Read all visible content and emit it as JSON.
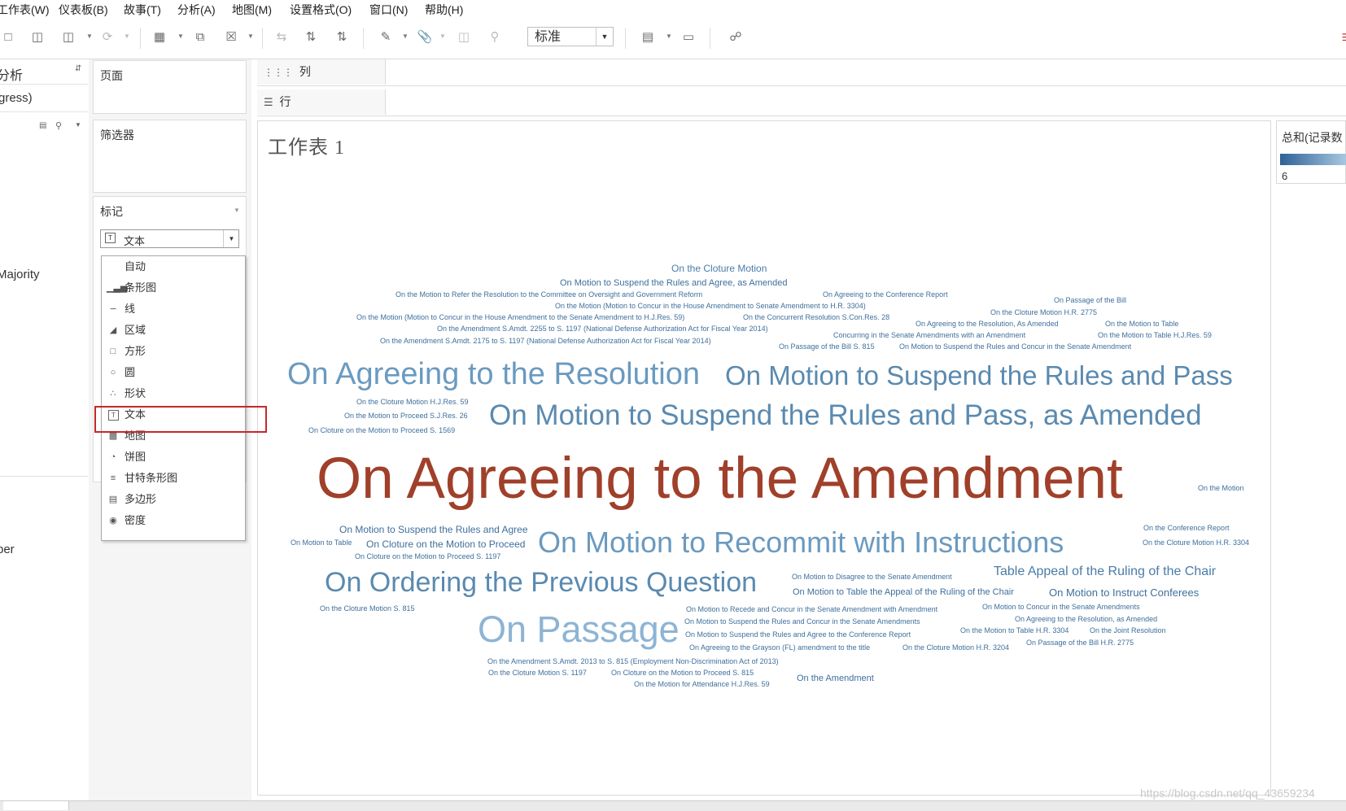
{
  "menu": [
    "工作表(W)",
    "仪表板(B)",
    "故事(T)",
    "分析(A)",
    "地图(M)",
    "设置格式(O)",
    "窗口(N)",
    "帮助(H)"
  ],
  "toolbar": {
    "fit_value": "标准",
    "icons": [
      "save-icon",
      "new-datasource-icon",
      "pause-datasource-icon",
      "refresh-icon",
      "new-worksheet-icon",
      "duplicate-sheet-icon",
      "clear-sheet-icon",
      "swap-icon",
      "sort-ascending-icon",
      "sort-descending-icon",
      "highlight-icon",
      "group-icon",
      "label-icon",
      "pin-icon",
      "show-me-icon",
      "presentation-icon",
      "share-icon"
    ]
  },
  "data_pane": {
    "header": "分析",
    "source": "gress)",
    "field_majority": "Majority",
    "field_ber": "ber"
  },
  "cards": {
    "pages": "页面",
    "filters": "筛选器",
    "marks": "标记",
    "mark_type": "文本"
  },
  "shelves": {
    "columns": "列",
    "rows": "行"
  },
  "view": {
    "title": "工作表 1",
    "words": [
      {
        "text": "On Agreeing to the Amendment",
        "color": "#a0402a"
      },
      {
        "text": "On Motion to Suspend the Rules and Pass, as Amended",
        "color": "#5a8ab0"
      },
      {
        "text": "On Motion to Suspend the Rules and Pass",
        "color": "#5a8ab0"
      },
      {
        "text": "On Agreeing to the Resolution",
        "color": "#6a9ac0"
      },
      {
        "text": "On Motion to Recommit with Instructions",
        "color": "#6a9ac0"
      },
      {
        "text": "On Ordering the Previous Question",
        "color": "#5a8ab0"
      },
      {
        "text": "On Passage",
        "color": "#8db4d4"
      },
      {
        "text": "On the Cloture Motion",
        "color": "#4a7ca8"
      },
      {
        "text": "On Motion to Suspend the Rules and Agree, as Amended",
        "color": "#3e6f9c"
      },
      {
        "text": "On the Motion to Refer the Resolution to the Committee on Oversight and Government Reform",
        "color": "#3e6f9c"
      },
      {
        "text": "On Agreeing to the Conference Report",
        "color": "#3e6f9c"
      },
      {
        "text": "On the Motion (Motion to Concur in the House Amendment to Senate Amendment to H.R. 3304)",
        "color": "#3e6f9c"
      },
      {
        "text": "On Passage of the Bill",
        "color": "#3e6f9c"
      },
      {
        "text": "On the Motion (Motion to Concur in the House Amendment to the Senate Amendment to H.J.Res. 59)",
        "color": "#3e6f9c"
      },
      {
        "text": "On the Concurrent Resolution S.Con.Res. 28",
        "color": "#3e6f9c"
      },
      {
        "text": "On the Cloture Motion H.R. 2775",
        "color": "#3e6f9c"
      },
      {
        "text": "On the Amendment S.Amdt. 2255 to S. 1197 (National Defense Authorization Act for Fiscal Year 2014)",
        "color": "#3e6f9c"
      },
      {
        "text": "On Agreeing to the Resolution, As Amended",
        "color": "#3e6f9c"
      },
      {
        "text": "On the Motion to Table",
        "color": "#3e6f9c"
      },
      {
        "text": "Concurring in the Senate Amendments with an Amendment",
        "color": "#3e6f9c"
      },
      {
        "text": "On the Motion to Table H.J.Res. 59",
        "color": "#3e6f9c"
      },
      {
        "text": "On the Amendment S.Amdt. 2175 to S. 1197 (National Defense Authorization Act for Fiscal Year 2014)",
        "color": "#3e6f9c"
      },
      {
        "text": "On Passage of the Bill S. 815",
        "color": "#3e6f9c"
      },
      {
        "text": "On Motion to Suspend the Rules and Concur in the Senate Amendment",
        "color": "#3e6f9c"
      },
      {
        "text": "On the Cloture Motion H.J.Res. 59",
        "color": "#3e6f9c"
      },
      {
        "text": "On the Motion to Proceed S.J.Res. 26",
        "color": "#3e6f9c"
      },
      {
        "text": "On Cloture on the Motion to Proceed S. 1569",
        "color": "#3e6f9c"
      },
      {
        "text": "On the Motion",
        "color": "#3e6f9c"
      },
      {
        "text": "On Motion to Suspend the Rules and Agree",
        "color": "#3e6f9c"
      },
      {
        "text": "On the Conference Report",
        "color": "#3e6f9c"
      },
      {
        "text": "On Motion to Table",
        "color": "#3e6f9c"
      },
      {
        "text": "On Cloture on the Motion to Proceed",
        "color": "#3e6f9c"
      },
      {
        "text": "On the Cloture Motion H.R. 3304",
        "color": "#3e6f9c"
      },
      {
        "text": "On Cloture on the Motion to Proceed S. 1197",
        "color": "#3e6f9c"
      },
      {
        "text": "On Motion to Disagree to the Senate Amendment",
        "color": "#3e6f9c"
      },
      {
        "text": "Table Appeal of the Ruling of the Chair",
        "color": "#4a7ca8"
      },
      {
        "text": "On Motion to Table the Appeal of the Ruling of the Chair",
        "color": "#3e6f9c"
      },
      {
        "text": "On Motion to Instruct Conferees",
        "color": "#3e6f9c"
      },
      {
        "text": "On the Cloture Motion S. 815",
        "color": "#3e6f9c"
      },
      {
        "text": "On Motion to Recede and Concur in the Senate Amendment with Amendment",
        "color": "#3e6f9c"
      },
      {
        "text": "On Motion to Concur in the Senate Amendments",
        "color": "#3e6f9c"
      },
      {
        "text": "On Motion to Suspend the Rules and Concur in the Senate Amendments",
        "color": "#3e6f9c"
      },
      {
        "text": "On Agreeing to the Resolution, as Amended",
        "color": "#3e6f9c"
      },
      {
        "text": "On Motion to Suspend the Rules and Agree to the Conference Report",
        "color": "#3e6f9c"
      },
      {
        "text": "On the Motion to Table H.R. 3304",
        "color": "#3e6f9c"
      },
      {
        "text": "On the Joint Resolution",
        "color": "#3e6f9c"
      },
      {
        "text": "On Agreeing to the Grayson (FL) amendment to the title",
        "color": "#3e6f9c"
      },
      {
        "text": "On the Cloture Motion H.R. 3204",
        "color": "#3e6f9c"
      },
      {
        "text": "On Passage of the Bill H.R. 2775",
        "color": "#3e6f9c"
      },
      {
        "text": "On the Amendment S.Amdt. 2013 to S. 815 (Employment Non-Discrimination Act of 2013)",
        "color": "#3e6f9c"
      },
      {
        "text": "On the Cloture Motion S. 1197",
        "color": "#3e6f9c"
      },
      {
        "text": "On Cloture on the Motion to Proceed S. 815",
        "color": "#3e6f9c"
      },
      {
        "text": "On the Amendment",
        "color": "#3e6f9c"
      },
      {
        "text": "On the Motion for Attendance H.J.Res. 59",
        "color": "#3e6f9c"
      }
    ]
  },
  "legend": {
    "title": "总和(记录数",
    "min_value": "6",
    "gradient_from": "#2e6296",
    "gradient_to": "#a9c8e2"
  },
  "dropdown": {
    "items": [
      {
        "label": "自动",
        "icon": "auto-icon"
      },
      {
        "label": "条形图",
        "icon": "bar-icon"
      },
      {
        "label": "线",
        "icon": "line-icon"
      },
      {
        "label": "区域",
        "icon": "area-icon"
      },
      {
        "label": "方形",
        "icon": "square-icon"
      },
      {
        "label": "圆",
        "icon": "circle-icon"
      },
      {
        "label": "形状",
        "icon": "shape-icon"
      },
      {
        "label": "文本",
        "icon": "text-icon"
      },
      {
        "label": "地图",
        "icon": "map-icon"
      },
      {
        "label": "饼图",
        "icon": "pie-icon"
      },
      {
        "label": "甘特条形图",
        "icon": "gantt-icon"
      },
      {
        "label": "多边形",
        "icon": "polygon-icon"
      },
      {
        "label": "密度",
        "icon": "density-icon"
      }
    ]
  },
  "watermark": "https://blog.csdn.net/qq_43659234"
}
